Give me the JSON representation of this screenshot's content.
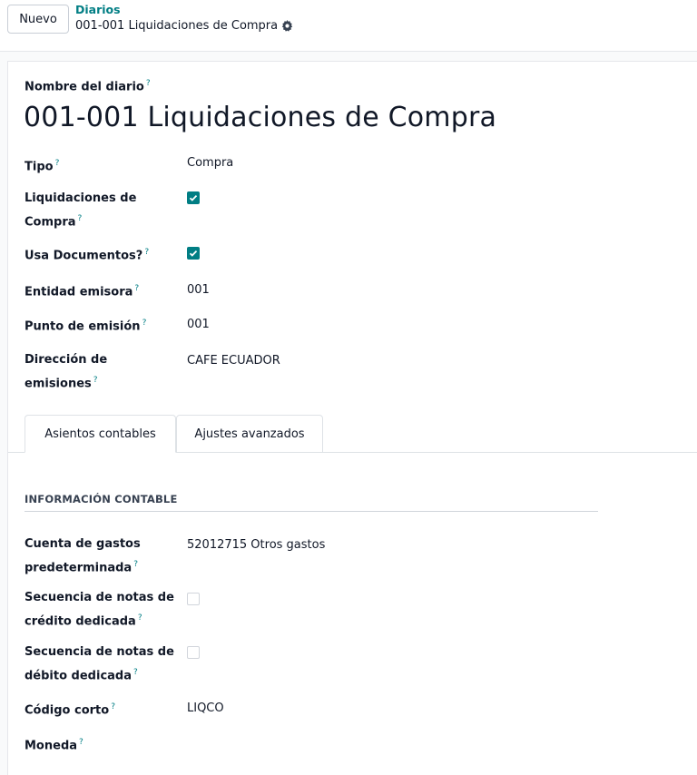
{
  "control_panel": {
    "new_button": "Nuevo",
    "breadcrumb_parent": "Diarios",
    "breadcrumb_current": "001-001 Liquidaciones de Compra"
  },
  "form": {
    "name_label": "Nombre del diario",
    "name_value": "001-001 Liquidaciones de Compra",
    "help_mark": "?",
    "fields": {
      "tipo": {
        "label": "Tipo",
        "value": "Compra"
      },
      "liquidaciones": {
        "label_line1": "Liquidaciones de",
        "label_line2": "Compra",
        "checked": true
      },
      "usa_documentos": {
        "label": "Usa Documentos?",
        "checked": true
      },
      "entidad": {
        "label": "Entidad emisora",
        "value": "001"
      },
      "punto": {
        "label": "Punto de emisión",
        "value": "001"
      },
      "direccion": {
        "label_line1": "Dirección de",
        "label_line2": "emisiones",
        "value": "CAFE ECUADOR"
      }
    },
    "tabs": [
      {
        "label": "Asientos contables",
        "active": true
      },
      {
        "label": "Ajustes avanzados",
        "active": false
      }
    ],
    "accounting_section": {
      "title": "INFORMACIÓN CONTABLE",
      "cuenta": {
        "label_line1": "Cuenta de gastos",
        "label_line2": "predeterminada",
        "value": "52012715 Otros gastos"
      },
      "sec_credito": {
        "label_line1": "Secuencia de notas de",
        "label_line2": "crédito dedicada",
        "checked": false
      },
      "sec_debito": {
        "label_line1": "Secuencia de notas de",
        "label_line2": "débito dedicada",
        "checked": false
      },
      "codigo": {
        "label": "Código corto",
        "value": "LIQCO"
      },
      "moneda": {
        "label": "Moneda",
        "value": ""
      }
    }
  },
  "colors": {
    "accent": "#017e84",
    "text": "#111827",
    "border": "#dee2e6"
  }
}
